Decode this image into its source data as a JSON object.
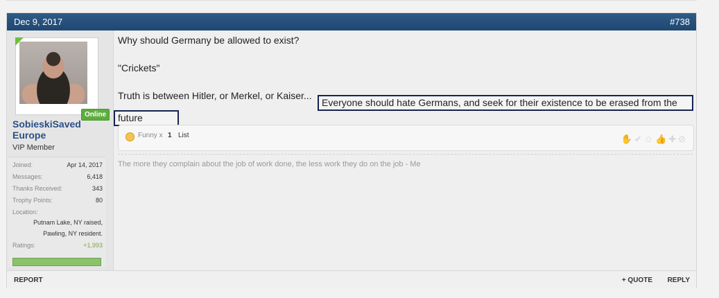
{
  "post": {
    "date": "Dec 9, 2017",
    "number": "#738"
  },
  "user": {
    "name": "SobieskiSaved Europe",
    "title": "VIP Member",
    "status": "Online",
    "avatar_icon": "user-avatar-icon",
    "stats": {
      "joined_label": "Joined:",
      "joined": "Apr 14, 2017",
      "messages_label": "Messages:",
      "messages": "6,418",
      "thanks_label": "Thanks Received:",
      "thanks": "343",
      "trophy_label": "Trophy Points:",
      "trophy": "80",
      "location_label": "Location:",
      "location_line1": "Putnam Lake, NY raised,",
      "location_line2": "Pawling, NY resident.",
      "ratings_label": "Ratings:",
      "ratings": "+1,993"
    }
  },
  "message": {
    "line1": "Why should Germany be allowed to exist?",
    "line2": "\"Crickets\"",
    "line3a": "Truth is between Hitler, or Merkel, or Kaiser...",
    "line3b": "Everyone should hate Germans, and seek for their existence to be erased from the",
    "line4": "future"
  },
  "reactions": {
    "label": "Funny x",
    "count": "1",
    "list_link": "List"
  },
  "signature": "The more they complain about the job of work done, the less work they do on the job - Me",
  "footer": {
    "report": "REPORT",
    "quote": "+ QUOTE",
    "reply": "REPLY"
  },
  "colors": {
    "header": "#2e5b86",
    "username": "#2a4f87",
    "online": "#5cae3c",
    "highlight_border": "#152450"
  }
}
